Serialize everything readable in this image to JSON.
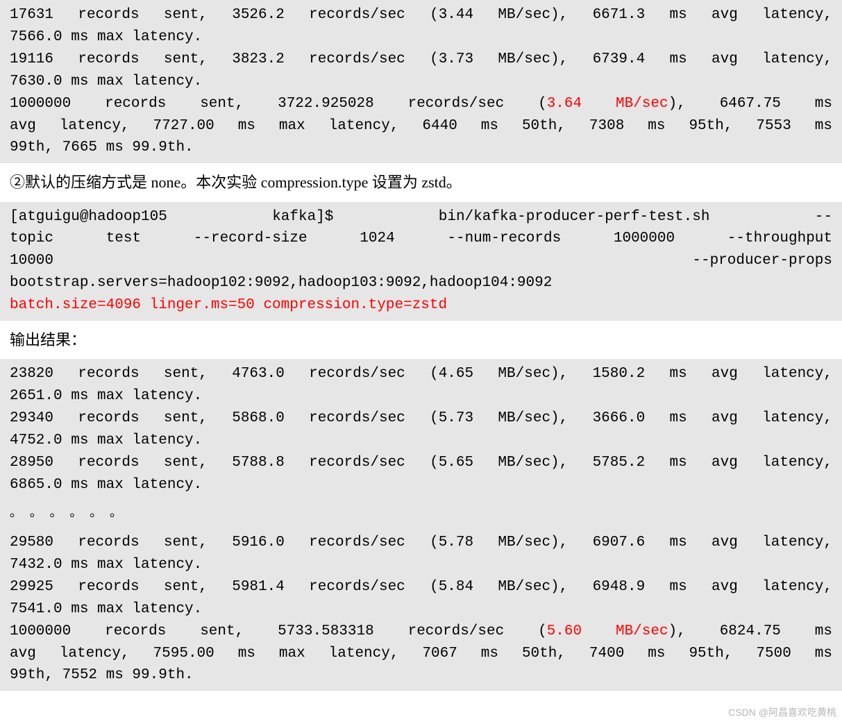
{
  "block1": {
    "l1a": "17631 records sent, 3526.2 records/sec (3.44 MB/sec), 6671.3 ms avg latency,",
    "l1b": "7566.0 ms max latency.",
    "l2a": "19116 records sent, 3823.2 records/sec (3.73 MB/sec), 6739.4 ms avg latency,",
    "l2b": "7630.0 ms max latency.",
    "l3a_pre": "1000000 records sent, 3722.925028 records/sec (",
    "l3a_red": "3.64 MB/sec",
    "l3a_post": "), 6467.75 ms",
    "l3b": "avg latency, 7727.00 ms max latency, 6440 ms 50th, 7308 ms 95th, 7553 ms",
    "l3c": "99th, 7665 ms 99.9th."
  },
  "para1": "②默认的压缩方式是 none。本次实验 compression.type 设置为 zstd。",
  "block2": {
    "l1": "[atguigu@hadoop105 kafka]$ bin/kafka-producer-perf-test.sh  --",
    "l2": "topic test --record-size 1024 --num-records 1000000 --throughput",
    "l3_left": "10000",
    "l3_right": "--producer-props",
    "l4": "bootstrap.servers=hadoop102:9092,hadoop103:9092,hadoop104:9092",
    "l5_red": "batch.size=4096 linger.ms=50 compression.type=zstd"
  },
  "para2": "输出结果：",
  "block3": {
    "l1a": "23820 records sent, 4763.0 records/sec (4.65 MB/sec), 1580.2 ms avg latency,",
    "l1b": "2651.0 ms max latency.",
    "l2a": "29340 records sent, 5868.0 records/sec (5.73 MB/sec), 3666.0 ms avg latency,",
    "l2b": "4752.0 ms max latency.",
    "l3a": "28950 records sent, 5788.8 records/sec (5.65 MB/sec), 5785.2 ms avg latency,",
    "l3b": "6865.0 ms max latency.",
    "ellipsis": "。 。 。  。 。 。",
    "l4a": "29580 records sent, 5916.0 records/sec (5.78 MB/sec), 6907.6 ms avg latency,",
    "l4b": "7432.0 ms max latency.",
    "l5a": "29925 records sent, 5981.4 records/sec (5.84 MB/sec), 6948.9 ms avg latency,",
    "l5b": "7541.0 ms max latency.",
    "l6a_pre": "1000000 records sent, 5733.583318 records/sec (",
    "l6a_red": "5.60 MB/sec",
    "l6a_post": "), 6824.75 ms",
    "l6b": "avg latency, 7595.00 ms max latency, 7067 ms 50th, 7400 ms 95th, 7500 ms",
    "l6c": "99th, 7552 ms 99.9th."
  },
  "watermark": "CSDN @阿昌喜欢吃黄桃"
}
